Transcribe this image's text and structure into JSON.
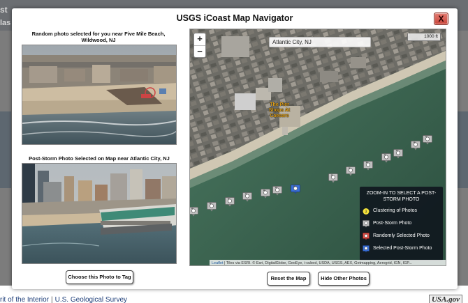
{
  "background": {
    "header_line1": "st",
    "header_line2": "las",
    "footer_links": [
      "rit of the Interior",
      "U.S. Geological Survey"
    ],
    "footer_logo": "USA.gov"
  },
  "modal": {
    "title": "USGS iCoast Map Navigator",
    "close_label": "X"
  },
  "left_panel": {
    "random_caption": "Random photo selected for you near Five Mile Beach, Wildwood, NJ",
    "poststorm_caption": "Post-Storm Photo Selected on Map near Atlantic City, NJ",
    "choose_button": "Choose this Photo to Tag"
  },
  "map": {
    "zoom_in": "+",
    "zoom_out": "−",
    "search_value": "Atlantic City, NJ",
    "scale_label": "1000 ft",
    "poi_label": "The Pier Shops At Caesars",
    "legend": {
      "title": "ZOOM-IN TO SELECT A POST-STORM PHOTO",
      "items": [
        {
          "label": "Clustering of Photos",
          "icon": "cluster-icon",
          "color": "#f4e23a"
        },
        {
          "label": "Post-Storm Photo",
          "icon": "camera-marker-icon",
          "color": "#bfbfbf"
        },
        {
          "label": "Randomly Selected Photo",
          "icon": "camera-marker-icon",
          "color": "#e0524a"
        },
        {
          "label": "Selected Post-Storm Photo",
          "icon": "camera-marker-icon",
          "color": "#3a6fd8"
        }
      ]
    },
    "attribution_link": "Leaflet",
    "attribution_text": " | Tiles via ESRI. © Esri, DigitalGlobe, GeoEye, i-cubed, USDA, USGS, AEX, Getmapping, Aerogrid, IGN, IGP..."
  },
  "buttons": {
    "reset": "Reset the Map",
    "hide": "Hide Other Photos"
  },
  "colors": {
    "close_button": "#d0564a",
    "marker_default": "#bfbfbf",
    "marker_selected": "#3a6fd8",
    "poi_text": "#e2a219"
  }
}
